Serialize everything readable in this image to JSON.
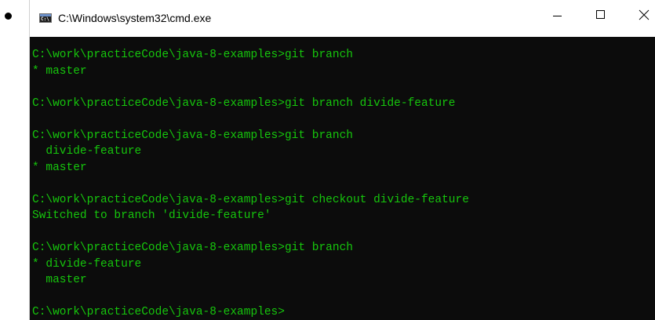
{
  "window": {
    "title": "C:\\Windows\\system32\\cmd.exe",
    "icon_text": "C:\\",
    "icon": "cmd-icon",
    "controls": [
      "minimize-icon",
      "maximize-icon",
      "close-icon"
    ]
  },
  "terminal": {
    "text_color": "#16c60c",
    "background": "#0c0c0c",
    "lines": [
      "C:\\work\\practiceCode\\java-8-examples>git branch",
      "* master",
      "",
      "C:\\work\\practiceCode\\java-8-examples>git branch divide-feature",
      "",
      "C:\\work\\practiceCode\\java-8-examples>git branch",
      "  divide-feature",
      "* master",
      "",
      "C:\\work\\practiceCode\\java-8-examples>git checkout divide-feature",
      "Switched to branch 'divide-feature'",
      "",
      "C:\\work\\practiceCode\\java-8-examples>git branch",
      "* divide-feature",
      "  master",
      "",
      "C:\\work\\practiceCode\\java-8-examples>"
    ]
  }
}
